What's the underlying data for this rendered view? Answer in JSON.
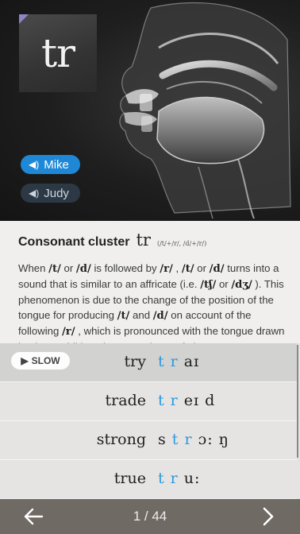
{
  "hero": {
    "symbol": "tr",
    "voices": [
      {
        "label": "Mike",
        "active": true
      },
      {
        "label": "Judy",
        "active": false
      }
    ]
  },
  "description": {
    "title": "Consonant cluster",
    "symbol": "tr",
    "note": "(/t/+/r/, /d/+/r/)",
    "body": [
      {
        "t": "When "
      },
      {
        "t": "/t/",
        "ph": true
      },
      {
        "t": " or "
      },
      {
        "t": "/d/",
        "ph": true
      },
      {
        "t": " is followed by "
      },
      {
        "t": "/r/",
        "ph": true
      },
      {
        "t": " , "
      },
      {
        "t": "/t/",
        "ph": true
      },
      {
        "t": " or "
      },
      {
        "t": "/d/",
        "ph": true
      },
      {
        "t": " turns into a sound that is similar to an affricate (i.e. "
      },
      {
        "t": "/tʃ/",
        "ph": true
      },
      {
        "t": " or "
      },
      {
        "t": "/dʒ/",
        "ph": true
      },
      {
        "t": " ). This phenomenon is due to the change of the position of the tongue for producing "
      },
      {
        "t": "/t/",
        "ph": true
      },
      {
        "t": " and "
      },
      {
        "t": "/d/",
        "ph": true
      },
      {
        "t": " on account of the following "
      },
      {
        "t": "/r/",
        "ph": true
      },
      {
        "t": " , which is pronounced with the tongue drawn back. In addition, the strong burst of air"
      }
    ]
  },
  "slow_label": "SLOW",
  "words": [
    {
      "word": "try",
      "ipa": [
        {
          "t": "t r",
          "hl": true
        },
        {
          "t": " aɪ"
        }
      ],
      "selected": true
    },
    {
      "word": "trade",
      "ipa": [
        {
          "t": "t r",
          "hl": true
        },
        {
          "t": " eɪ d"
        }
      ],
      "selected": false
    },
    {
      "word": "strong",
      "ipa": [
        {
          "t": "s "
        },
        {
          "t": "t r",
          "hl": true
        },
        {
          "t": " ɔ: ŋ"
        }
      ],
      "selected": false
    },
    {
      "word": "true",
      "ipa": [
        {
          "t": "t r",
          "hl": true
        },
        {
          "t": " u:"
        }
      ],
      "selected": false
    }
  ],
  "footer": {
    "prev_icon": "arrow-left-icon",
    "next_icon": "chevron-right-icon",
    "page": "1 / 44"
  },
  "colors": {
    "accent": "#2b9ae0",
    "voice_active": "#1f88d6",
    "footer": "#6f6a63"
  }
}
